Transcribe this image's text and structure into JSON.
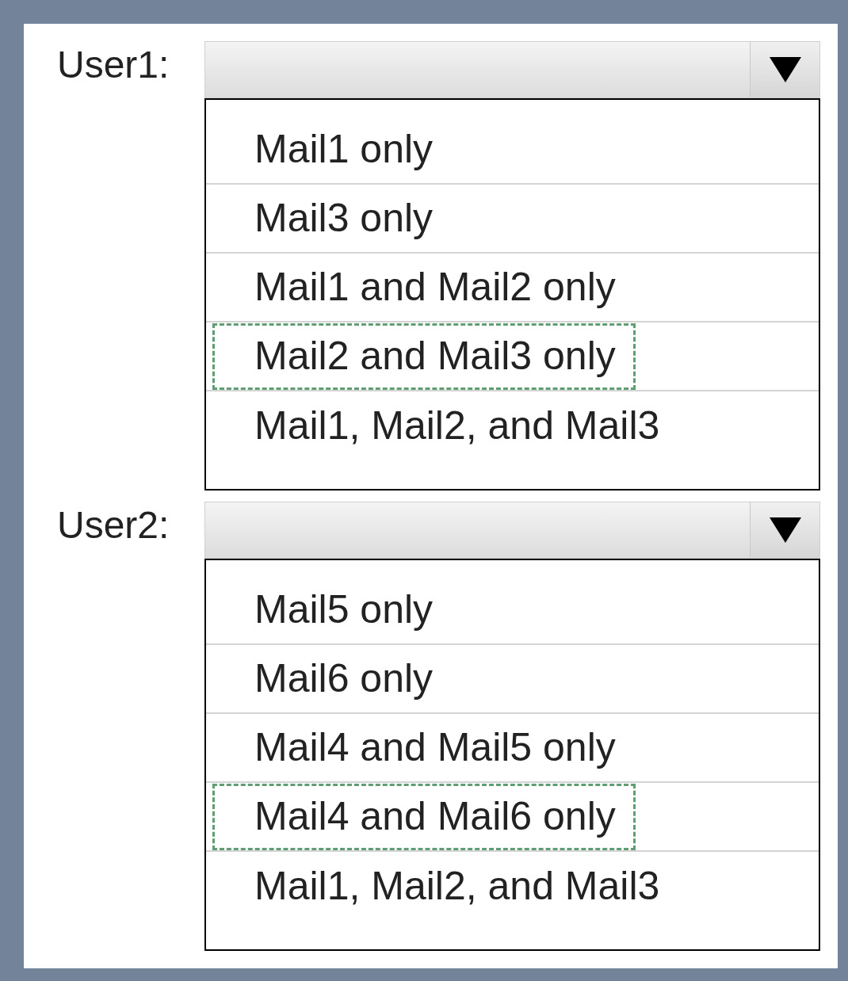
{
  "questions": [
    {
      "label": "User1:",
      "options": [
        {
          "text": "Mail1 only",
          "selected": false
        },
        {
          "text": "Mail3 only",
          "selected": false
        },
        {
          "text": "Mail1 and Mail2 only",
          "selected": false
        },
        {
          "text": "Mail2 and Mail3 only",
          "selected": true
        },
        {
          "text": "Mail1, Mail2, and Mail3",
          "selected": false
        }
      ]
    },
    {
      "label": "User2:",
      "options": [
        {
          "text": "Mail5 only",
          "selected": false
        },
        {
          "text": "Mail6 only",
          "selected": false
        },
        {
          "text": "Mail4 and Mail5 only",
          "selected": false
        },
        {
          "text": "Mail4 and Mail6 only",
          "selected": true
        },
        {
          "text": "Mail1, Mail2, and Mail3",
          "selected": false
        }
      ]
    }
  ]
}
